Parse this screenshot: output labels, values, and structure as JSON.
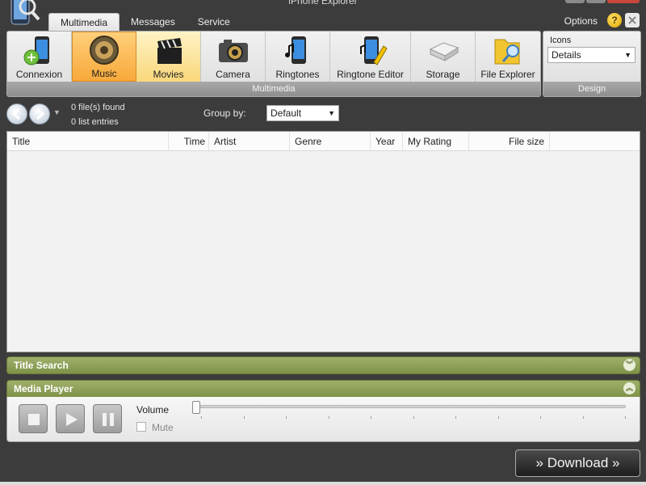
{
  "window": {
    "title": "iPhone Explorer"
  },
  "tabs": [
    {
      "label": "Multimedia",
      "active": true
    },
    {
      "label": "Messages",
      "active": false
    },
    {
      "label": "Service",
      "active": false
    }
  ],
  "header": {
    "options_label": "Options",
    "help_label": "?"
  },
  "ribbon": {
    "group_label": "Multimedia",
    "items": [
      {
        "label": "Connexion",
        "icon": "phone-connexion-icon",
        "state": "normal"
      },
      {
        "label": "Music",
        "icon": "speaker-icon",
        "state": "active"
      },
      {
        "label": "Movies",
        "icon": "clapperboard-icon",
        "state": "hover"
      },
      {
        "label": "Camera",
        "icon": "camera-icon",
        "state": "normal"
      },
      {
        "label": "Ringtones",
        "icon": "phone-music-icon",
        "state": "normal"
      },
      {
        "label": "Ringtone Editor",
        "icon": "phone-edit-icon",
        "state": "normal"
      },
      {
        "label": "Storage",
        "icon": "storage-drive-icon",
        "state": "normal"
      },
      {
        "label": "File Explorer",
        "icon": "folder-search-icon",
        "state": "normal"
      }
    ]
  },
  "design": {
    "icons_label": "Icons",
    "view_value": "Details",
    "group_label": "Design"
  },
  "nav": {
    "files_found": "0 file(s) found",
    "list_entries": "0 list entries",
    "group_by_label": "Group by:",
    "group_by_value": "Default"
  },
  "table": {
    "columns": [
      {
        "label": "Title",
        "align": "left"
      },
      {
        "label": "Time",
        "align": "right"
      },
      {
        "label": "Artist",
        "align": "left"
      },
      {
        "label": "Genre",
        "align": "left"
      },
      {
        "label": "Year",
        "align": "left"
      },
      {
        "label": "My Rating",
        "align": "left"
      },
      {
        "label": "File size",
        "align": "right"
      }
    ],
    "rows": []
  },
  "panels": {
    "title_search": "Title Search",
    "media_player": "Media Player"
  },
  "player": {
    "volume_label": "Volume",
    "mute_label": "Mute",
    "volume_level": 0,
    "muted": false
  },
  "download": {
    "label": "» Download »"
  },
  "colors": {
    "accent_orange": "#f7a93a",
    "panel_green": "#8a9b55",
    "button_dark": "#2a2a2a"
  }
}
